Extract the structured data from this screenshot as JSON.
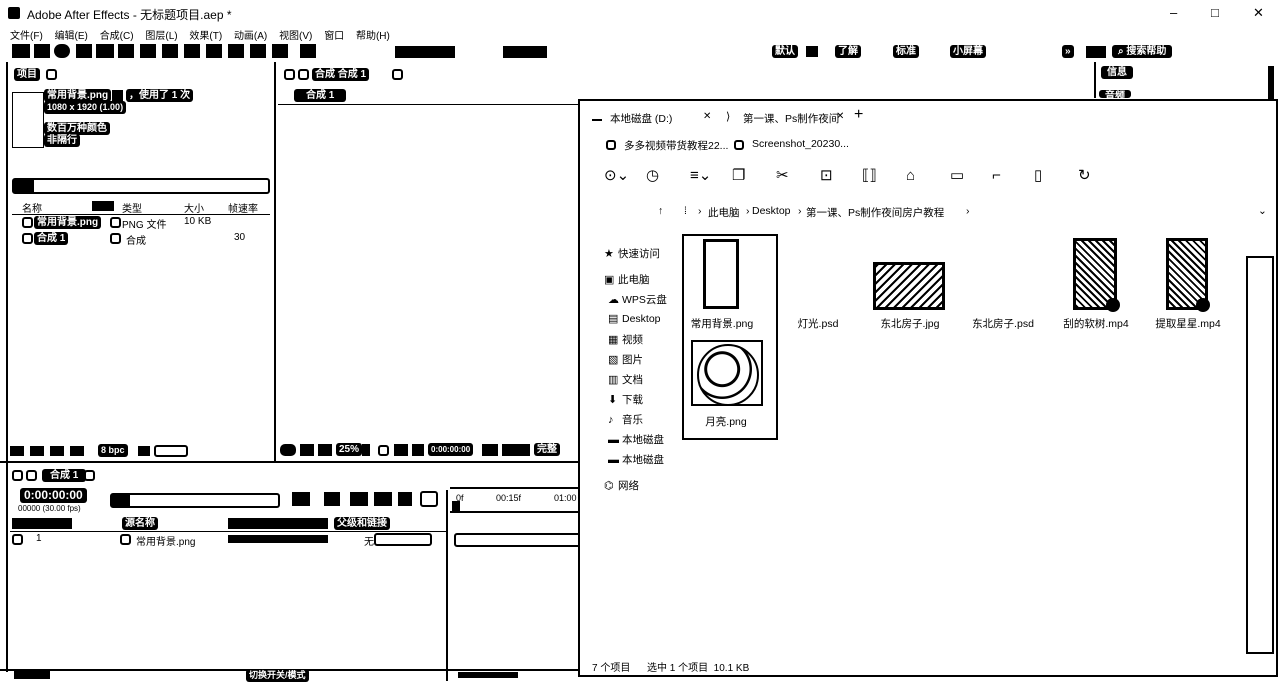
{
  "window": {
    "title": "Adobe After Effects - 无标题项目.aep *",
    "min": "–",
    "max": "□",
    "close": "✕"
  },
  "menu": [
    "文件(F)",
    "编辑(E)",
    "合成(C)",
    "图层(L)",
    "效果(T)",
    "动画(A)",
    "视图(V)",
    "窗口",
    "帮助(H)"
  ],
  "toolbar": {
    "workspaces": [
      "默认",
      "了解",
      "标准",
      "小屏幕"
    ],
    "more": "»",
    "search": "搜索帮助"
  },
  "project_panel": {
    "title": "项目",
    "asset_name": "常用背景.png",
    "used_label": "，使用了 1 次",
    "asset_dims": "1080 x 1920 (1.00)",
    "color_line1": "数百万种颜色",
    "color_line2": "非隔行",
    "columns": [
      "名称",
      "类型",
      "大小",
      "帧速率"
    ],
    "rows": [
      {
        "name": "常用背景.png",
        "type": "PNG 文件",
        "size": "10 KB",
        "fps": ""
      },
      {
        "name": "合成 1",
        "type": "合成",
        "size": "",
        "fps": "30"
      }
    ],
    "bpc": "8 bpc"
  },
  "comp_panel": {
    "title": "合成 合成 1",
    "tab": "合成 1",
    "zoom": "25%",
    "timecode": "0:00:00:00",
    "quality": "完整"
  },
  "right_panels": {
    "info": "信息",
    "audio": "音频"
  },
  "timeline": {
    "tab": "合成 1",
    "timecode": "0:00:00:00",
    "frame_info": "00000 (30.00 fps)",
    "col_source": "源名称",
    "col_parent": "父级和链接",
    "layer_num": "1",
    "layer_name": "常用背景.png",
    "parent_value": "无",
    "ruler": [
      "0f",
      "00:15f",
      "01:00"
    ],
    "toggle": "切换开关/模式"
  },
  "explorer": {
    "tabs": [
      "本地磁盘 (D:)",
      "第一课、Ps制作夜间"
    ],
    "new_tab": "+",
    "tab_close": "✕",
    "subtabs": [
      "多多视频带货教程22...",
      "Screenshot_20230..."
    ],
    "path": [
      "此电脑",
      "Desktop",
      "第一课、Ps制作夜间房户教程"
    ],
    "nav": [
      {
        "icon": "★",
        "label": "快速访问"
      },
      {
        "icon": "▣",
        "label": "此电脑"
      },
      {
        "icon": "☁",
        "label": "WPS云盘"
      },
      {
        "icon": "▤",
        "label": "Desktop"
      },
      {
        "icon": "▦",
        "label": "视频"
      },
      {
        "icon": "▧",
        "label": "图片"
      },
      {
        "icon": "▥",
        "label": "文档"
      },
      {
        "icon": "⬇",
        "label": "下载"
      },
      {
        "icon": "♪",
        "label": "音乐"
      },
      {
        "icon": "▬",
        "label": "本地磁盘"
      },
      {
        "icon": "▬",
        "label": "本地磁盘"
      },
      {
        "icon": "⌬",
        "label": "网络"
      }
    ],
    "files": [
      {
        "name": "常用背景.png"
      },
      {
        "name": "灯光.psd"
      },
      {
        "name": "东北房子.jpg"
      },
      {
        "name": "东北房子.psd"
      },
      {
        "name": "刮的软树.mp4"
      },
      {
        "name": "提取星星.mp4"
      },
      {
        "name": "月亮.png"
      }
    ],
    "status_count": "7 个项目",
    "status_selected": "选中 1 个项目  10.1 KB"
  }
}
